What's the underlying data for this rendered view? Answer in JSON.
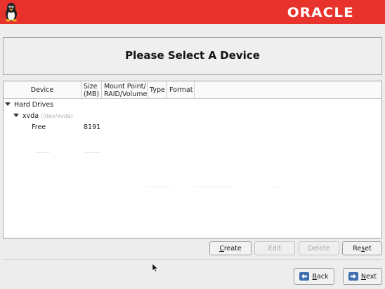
{
  "banner": {
    "brand_text": "ORACLE",
    "logo_icon": "tux-penguin-icon",
    "color": "#e8332c"
  },
  "header": {
    "title": "Please Select A Device"
  },
  "table": {
    "columns": [
      "Device",
      "Size (MB)",
      "Mount Point/ RAID/Volume",
      "Type",
      "Format"
    ],
    "col_size_line1": "Size",
    "col_size_line2": "(MB)",
    "col_mount_line1": "Mount Point/",
    "col_mount_line2": "RAID/Volume",
    "groups": [
      {
        "label": "Hard Drives",
        "children": [
          {
            "label": "xvda",
            "path": "(/dev/xvda)",
            "children": [
              {
                "device": "Free",
                "size": "8191"
              }
            ]
          }
        ]
      }
    ]
  },
  "actions": {
    "create_prefix": "",
    "create_u": "C",
    "create_rest": "reate",
    "edit": "Edit",
    "delete": "Delete",
    "reset_prefix": "Re",
    "reset_u": "s",
    "reset_rest": "et"
  },
  "nav": {
    "back_u": "B",
    "back_rest": "ack",
    "next_u": "N",
    "next_rest": "ext"
  }
}
